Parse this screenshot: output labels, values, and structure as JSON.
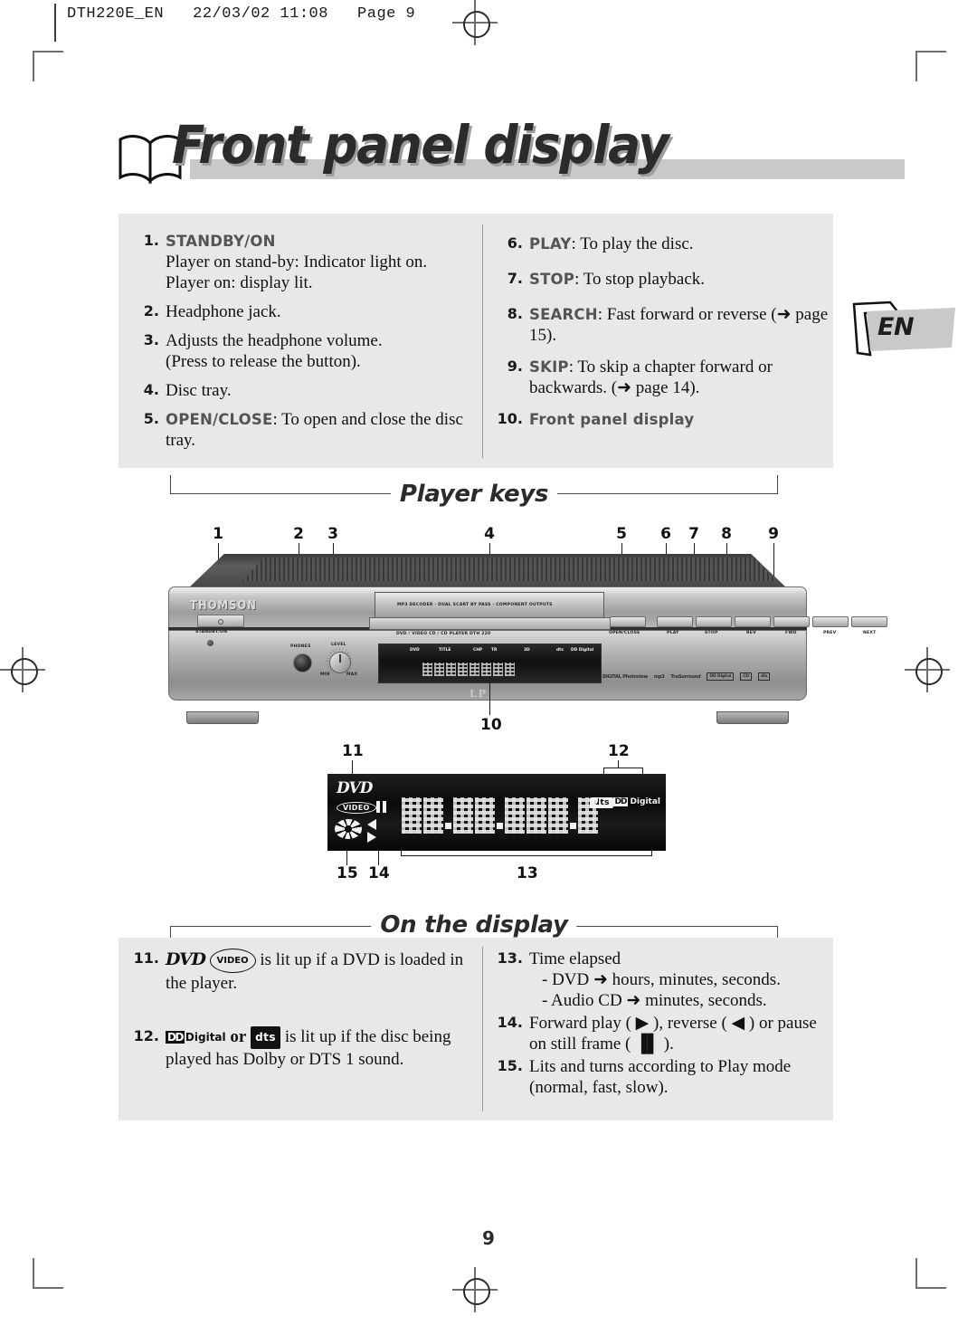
{
  "slug": "DTH220E_EN   22/03/02 11:08   Page 9",
  "title": "Front panel display",
  "language_tab": "EN",
  "page_number": "9",
  "player_keys": {
    "heading": "Player keys",
    "left_items": [
      {
        "num": "1.",
        "keyword": "STANDBY/ON",
        "text": "",
        "lines": [
          "Player on stand-by: Indicator light on.",
          "Player on: display lit."
        ]
      },
      {
        "num": "2.",
        "keyword": "",
        "text": "Headphone jack.",
        "lines": []
      },
      {
        "num": "3.",
        "keyword": "",
        "text": "Adjusts the headphone volume.",
        "lines": [
          "(Press to release the button)."
        ]
      },
      {
        "num": "4.",
        "keyword": "",
        "text": "Disc tray.",
        "lines": []
      },
      {
        "num": "5.",
        "keyword": "OPEN/CLOSE",
        "text": ": To open and close the disc tray.",
        "lines": []
      }
    ],
    "right_items": [
      {
        "num": "6.",
        "keyword": "PLAY",
        "text": ": To play the disc."
      },
      {
        "num": "7.",
        "keyword": "STOP",
        "text": ": To stop playback."
      },
      {
        "num": "8.",
        "keyword": "SEARCH",
        "text": ": Fast forward or reverse (➜ page 15)."
      },
      {
        "num": "9.",
        "keyword": "SKIP",
        "text": ": To skip a chapter forward or backwards. (➜ page 14)."
      },
      {
        "num": "10.",
        "keyword": "Front panel display",
        "text": ""
      }
    ],
    "callouts": [
      "1",
      "2",
      "3",
      "4",
      "5",
      "6",
      "7",
      "8",
      "9",
      "10"
    ]
  },
  "device": {
    "brand": "THOMSON",
    "standby_label": "STANDBY/ON",
    "phones_label": "PHONES",
    "level_label": "LEVEL",
    "level_min": "MIN",
    "level_max": "MAX",
    "tray_banner": "MP3 DECODER · DUAL SCART BY PASS · COMPONENT OUTPUTS",
    "model_line": "DVD / VIDEO CD / CD PLAYER DTH 220",
    "buttons": [
      "OPEN/CLOSE",
      "PLAY",
      "STOP",
      "REV",
      "FWD",
      "PREV",
      "NEXT"
    ],
    "display_indicators": [
      "DVD",
      "TITLE",
      "CHP",
      "TR",
      "3D",
      "dts",
      "DD Digital"
    ],
    "logos": [
      "DIGITAL Photoview",
      "mp3",
      "TruSurround",
      "DD Digital",
      "CD",
      "dts"
    ],
    "lp_mark": "LP"
  },
  "display_closeup": {
    "dvd_logo": "DVD",
    "video_badge": "VIDEO",
    "dts_badge": "dts",
    "dolby_badge_mark": "DD",
    "dolby_badge_text": "Digital",
    "callouts": [
      "11",
      "12",
      "13",
      "14",
      "15"
    ]
  },
  "on_the_display": {
    "heading": "On the display",
    "items": [
      {
        "num": "11.",
        "pre_logo": [
          "DVD",
          "VIDEO"
        ],
        "text": "is lit up if a DVD is loaded in the player."
      },
      {
        "num": "12.",
        "logo_a": "DD Digital",
        "conj": "or",
        "logo_b": "dts",
        "text": "is lit up if the disc being played has Dolby or DTS 1 sound."
      },
      {
        "num": "13.",
        "text": "Time elapsed",
        "sublines": [
          "- DVD ➜ hours, minutes, seconds.",
          "- Audio CD ➜ minutes, seconds."
        ]
      },
      {
        "num": "14.",
        "text": "Forward play ( ▶ ), reverse ( ◀ ) or pause on still frame ( ▐▌ )."
      },
      {
        "num": "15.",
        "text": "Lits and turns according to Play mode (normal, fast, slow)."
      }
    ]
  }
}
